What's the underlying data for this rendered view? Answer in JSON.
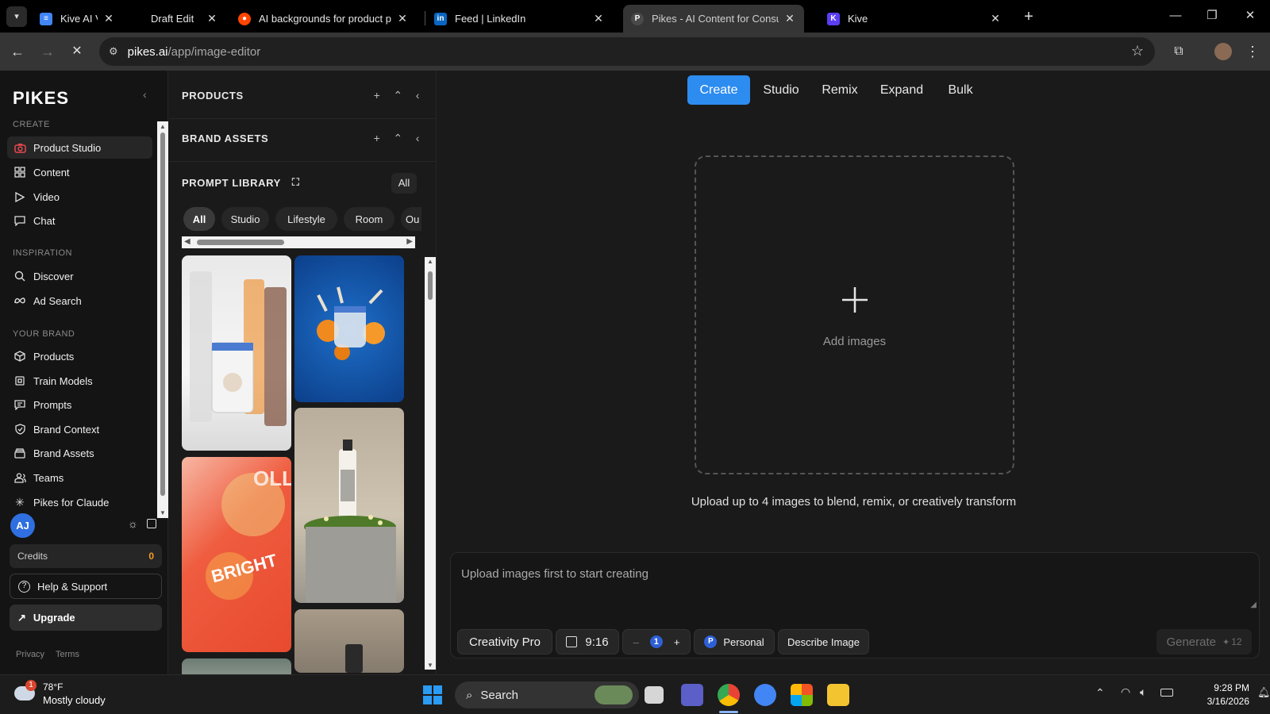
{
  "browser": {
    "tabs": [
      {
        "label": "Kive AI Vs",
        "active": false
      },
      {
        "label": "Draft Edit",
        "active": false
      },
      {
        "label": "AI backgrounds for product pho",
        "active": false
      },
      {
        "label": "Feed | LinkedIn",
        "active": false
      },
      {
        "label": "Pikes - AI Content for Consume",
        "active": true
      },
      {
        "label": "Kive",
        "active": false
      }
    ],
    "url_domain": "pikes.ai",
    "url_path": "/app/image-editor"
  },
  "sidebar": {
    "logo": "PIKES",
    "sections": {
      "create": "CREATE",
      "inspiration": "INSPIRATION",
      "your_brand": "YOUR BRAND"
    },
    "create_items": [
      {
        "label": "Product Studio",
        "icon": "camera-icon",
        "active": true
      },
      {
        "label": "Content",
        "icon": "grid-icon"
      },
      {
        "label": "Video",
        "icon": "play-icon"
      },
      {
        "label": "Chat",
        "icon": "chat-icon"
      }
    ],
    "inspiration_items": [
      {
        "label": "Discover",
        "icon": "search-icon"
      },
      {
        "label": "Ad Search",
        "icon": "meta-icon"
      }
    ],
    "brand_items": [
      {
        "label": "Products",
        "icon": "box-icon"
      },
      {
        "label": "Train Models",
        "icon": "cpu-icon"
      },
      {
        "label": "Prompts",
        "icon": "message-icon"
      },
      {
        "label": "Brand Context",
        "icon": "shield-icon"
      },
      {
        "label": "Brand Assets",
        "icon": "archive-icon"
      },
      {
        "label": "Teams",
        "icon": "users-icon"
      },
      {
        "label": "Pikes for Claude",
        "icon": "spark-icon"
      }
    ],
    "avatar_initials": "AJ",
    "credits_label": "Credits",
    "credits_value": "0",
    "help_label": "Help & Support",
    "upgrade_label": "Upgrade",
    "footer_links": [
      "Privacy",
      "Terms"
    ]
  },
  "panel": {
    "products_title": "PRODUCTS",
    "brand_assets_title": "BRAND ASSETS",
    "prompt_library_title": "PROMPT LIBRARY",
    "filter_button": "All",
    "chips": [
      "All",
      "Studio",
      "Lifestyle",
      "Room",
      "Ou"
    ]
  },
  "main": {
    "tabs": [
      "Create",
      "Studio",
      "Remix",
      "Expand",
      "Bulk"
    ],
    "active_tab": "Create",
    "dropzone_label": "Add images",
    "upload_hint": "Upload up to 4 images to blend, remix, or creatively transform",
    "prompt_placeholder": "Upload images first to start creating",
    "model_button": "Creativity Pro",
    "aspect_ratio": "9:16",
    "count_value": "1",
    "count_minus": "–",
    "count_plus": "+",
    "workspace_initial": "P",
    "workspace_label": "Personal",
    "describe_button": "Describe Image",
    "generate_label": "Generate",
    "generate_cost": "12"
  },
  "taskbar": {
    "weather_temp": "78°F",
    "weather_desc": "Mostly cloudy",
    "weather_badge": "1",
    "search_label": "Search",
    "time": "9:28 PM",
    "date": "3/16/2026"
  },
  "colors": {
    "accent": "#2d8cf0",
    "credits": "#f59a23",
    "active_icon": "#e5484d"
  }
}
